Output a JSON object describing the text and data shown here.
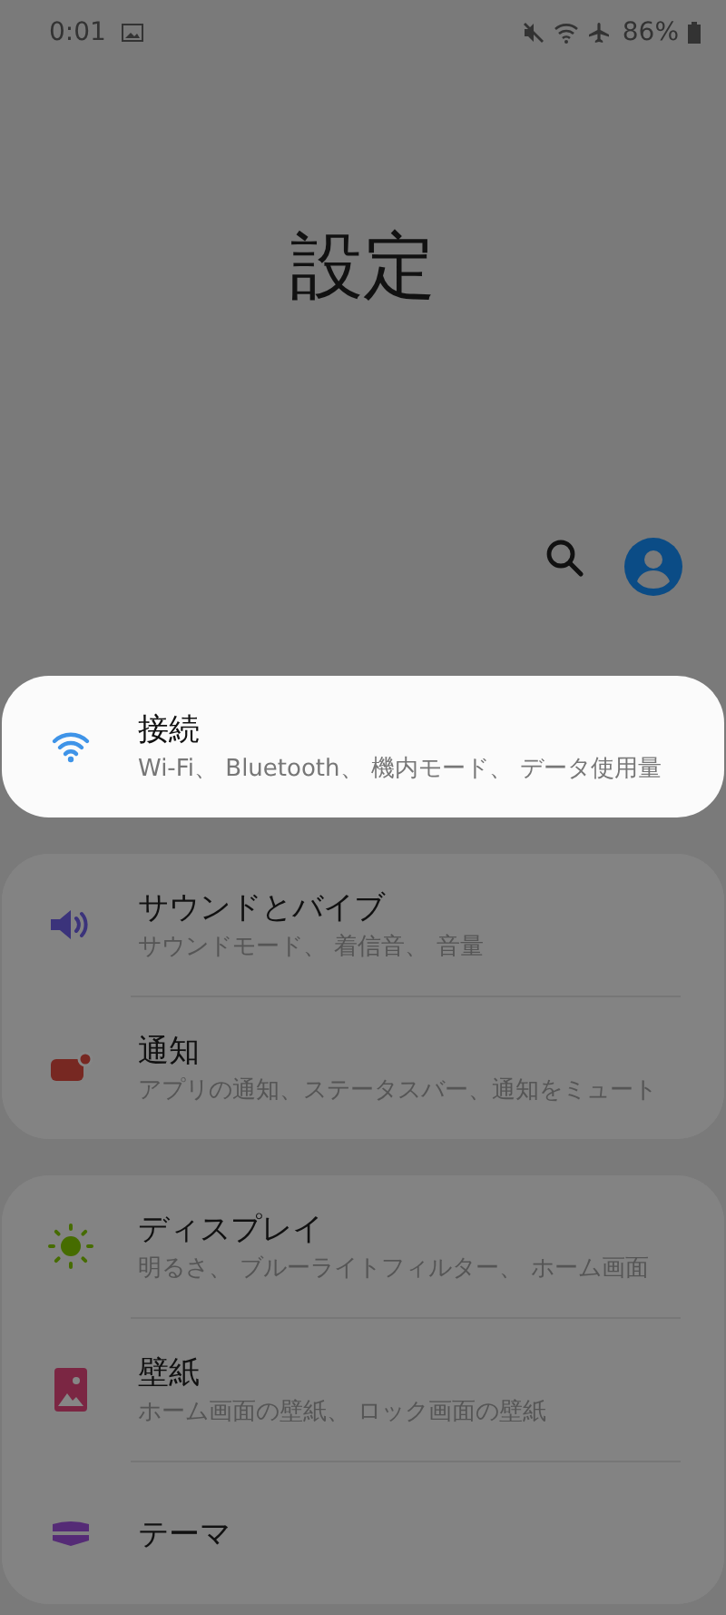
{
  "status_bar": {
    "time": "0:01",
    "battery": "86%"
  },
  "title": "設定",
  "groups": [
    {
      "items": [
        {
          "kind": "wifi",
          "title": "接続",
          "subtitle": "Wi-Fi、 Bluetooth、 機内モード、 データ使用量",
          "selected": true
        }
      ]
    },
    {
      "items": [
        {
          "kind": "sound",
          "title": "サウンドとバイブ",
          "subtitle": "サウンドモード、 着信音、 音量",
          "selected": false
        },
        {
          "kind": "notification",
          "title": "通知",
          "subtitle": "アプリの通知、ステータスバー、通知をミュート",
          "selected": false
        }
      ]
    },
    {
      "items": [
        {
          "kind": "display",
          "title": "ディスプレイ",
          "subtitle": "明るさ、 ブルーライトフィルター、 ホーム画面",
          "selected": false
        },
        {
          "kind": "wallpaper",
          "title": "壁紙",
          "subtitle": "ホーム画面の壁紙、 ロック画面の壁紙",
          "selected": false
        },
        {
          "kind": "theme",
          "title": "テーマ",
          "selected": false
        }
      ]
    }
  ]
}
